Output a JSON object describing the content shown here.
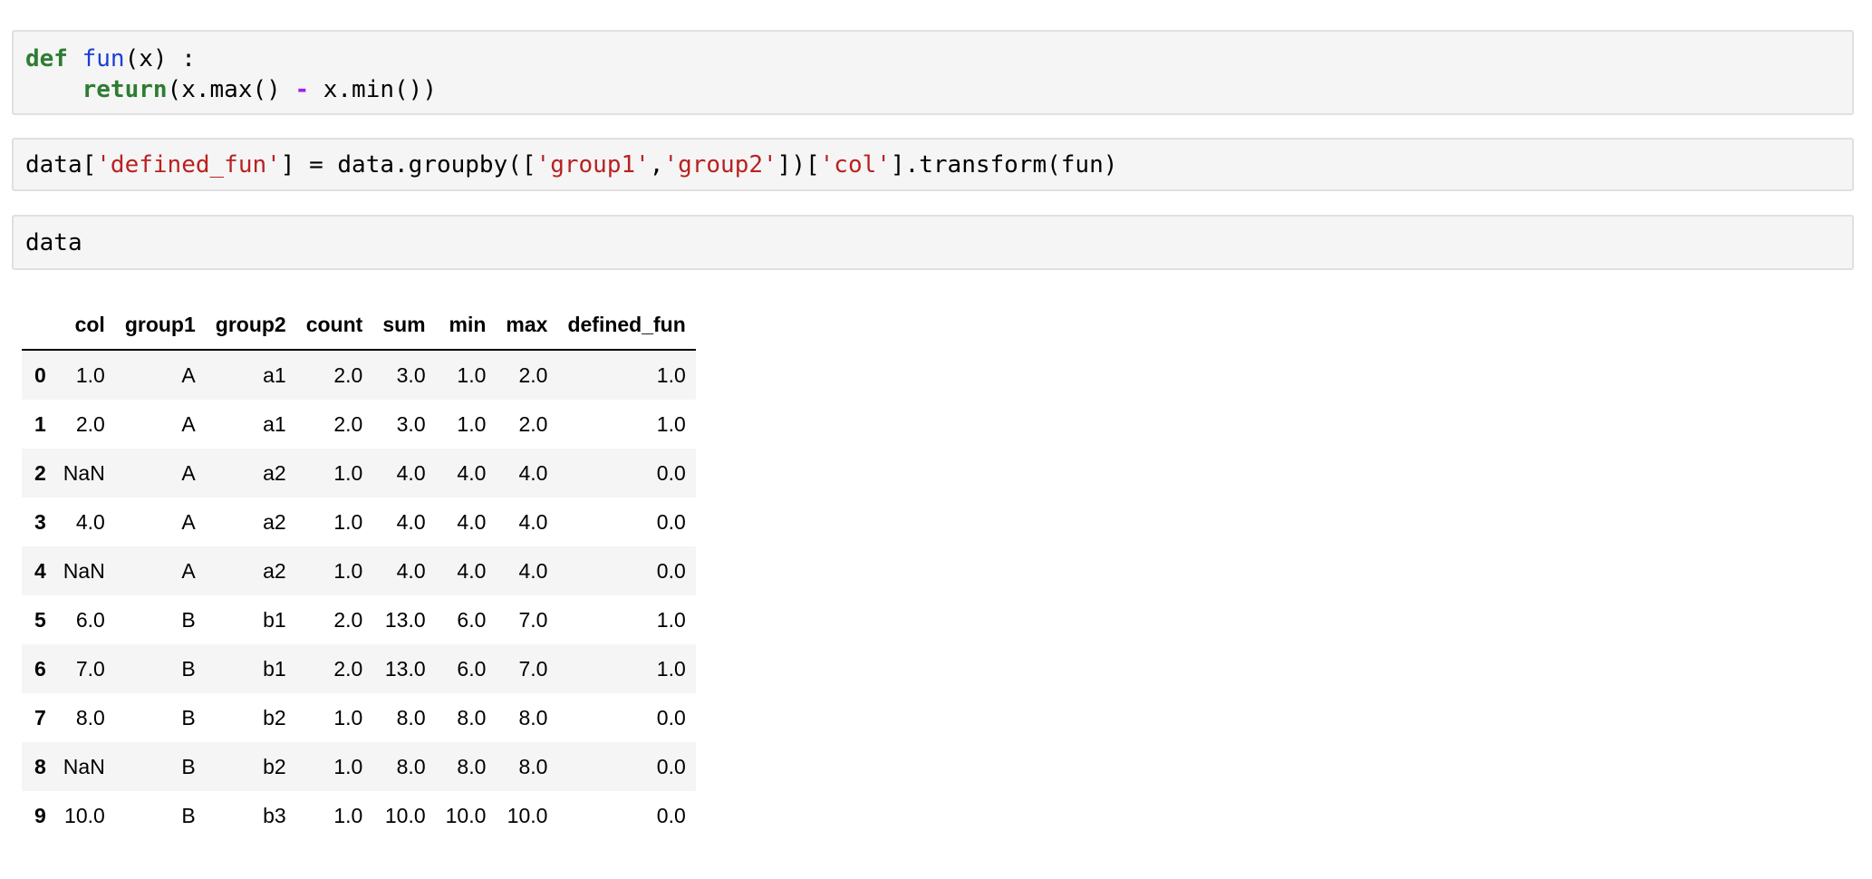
{
  "cells": [
    {
      "lines": [
        [
          {
            "t": "def",
            "c": "kw"
          },
          {
            "t": " ",
            "c": ""
          },
          {
            "t": "fun",
            "c": "fn"
          },
          {
            "t": "(x) :",
            "c": ""
          }
        ],
        [
          {
            "t": "    ",
            "c": ""
          },
          {
            "t": "return",
            "c": "kw"
          },
          {
            "t": "(x.max() ",
            "c": ""
          },
          {
            "t": "-",
            "c": "op"
          },
          {
            "t": " x.min())",
            "c": ""
          }
        ]
      ]
    },
    {
      "lines": [
        [
          {
            "t": "data[",
            "c": ""
          },
          {
            "t": "'defined_fun'",
            "c": "str"
          },
          {
            "t": "] = data.groupby([",
            "c": ""
          },
          {
            "t": "'group1'",
            "c": "str"
          },
          {
            "t": ",",
            "c": ""
          },
          {
            "t": "'group2'",
            "c": "str"
          },
          {
            "t": "])[",
            "c": ""
          },
          {
            "t": "'col'",
            "c": "str"
          },
          {
            "t": "].transform(fun)",
            "c": ""
          }
        ]
      ]
    },
    {
      "lines": [
        [
          {
            "t": "data",
            "c": ""
          }
        ]
      ]
    }
  ],
  "table": {
    "columns": [
      "",
      "col",
      "group1",
      "group2",
      "count",
      "sum",
      "min",
      "max",
      "defined_fun"
    ],
    "rows": [
      {
        "index": "0",
        "values": [
          "1.0",
          "A",
          "a1",
          "2.0",
          "3.0",
          "1.0",
          "2.0",
          "1.0"
        ]
      },
      {
        "index": "1",
        "values": [
          "2.0",
          "A",
          "a1",
          "2.0",
          "3.0",
          "1.0",
          "2.0",
          "1.0"
        ]
      },
      {
        "index": "2",
        "values": [
          "NaN",
          "A",
          "a2",
          "1.0",
          "4.0",
          "4.0",
          "4.0",
          "0.0"
        ]
      },
      {
        "index": "3",
        "values": [
          "4.0",
          "A",
          "a2",
          "1.0",
          "4.0",
          "4.0",
          "4.0",
          "0.0"
        ]
      },
      {
        "index": "4",
        "values": [
          "NaN",
          "A",
          "a2",
          "1.0",
          "4.0",
          "4.0",
          "4.0",
          "0.0"
        ]
      },
      {
        "index": "5",
        "values": [
          "6.0",
          "B",
          "b1",
          "2.0",
          "13.0",
          "6.0",
          "7.0",
          "1.0"
        ]
      },
      {
        "index": "6",
        "values": [
          "7.0",
          "B",
          "b1",
          "2.0",
          "13.0",
          "6.0",
          "7.0",
          "1.0"
        ]
      },
      {
        "index": "7",
        "values": [
          "8.0",
          "B",
          "b2",
          "1.0",
          "8.0",
          "8.0",
          "8.0",
          "0.0"
        ]
      },
      {
        "index": "8",
        "values": [
          "NaN",
          "B",
          "b2",
          "1.0",
          "8.0",
          "8.0",
          "8.0",
          "0.0"
        ]
      },
      {
        "index": "9",
        "values": [
          "10.0",
          "B",
          "b3",
          "1.0",
          "10.0",
          "10.0",
          "10.0",
          "0.0"
        ]
      }
    ]
  },
  "colors": {
    "keyword": "#2e7d32",
    "function_name": "#1a3fd6",
    "string": "#ba2121",
    "operator": "#a020f0",
    "cell_background": "#f5f5f5",
    "cell_border": "#e0e0e0"
  }
}
